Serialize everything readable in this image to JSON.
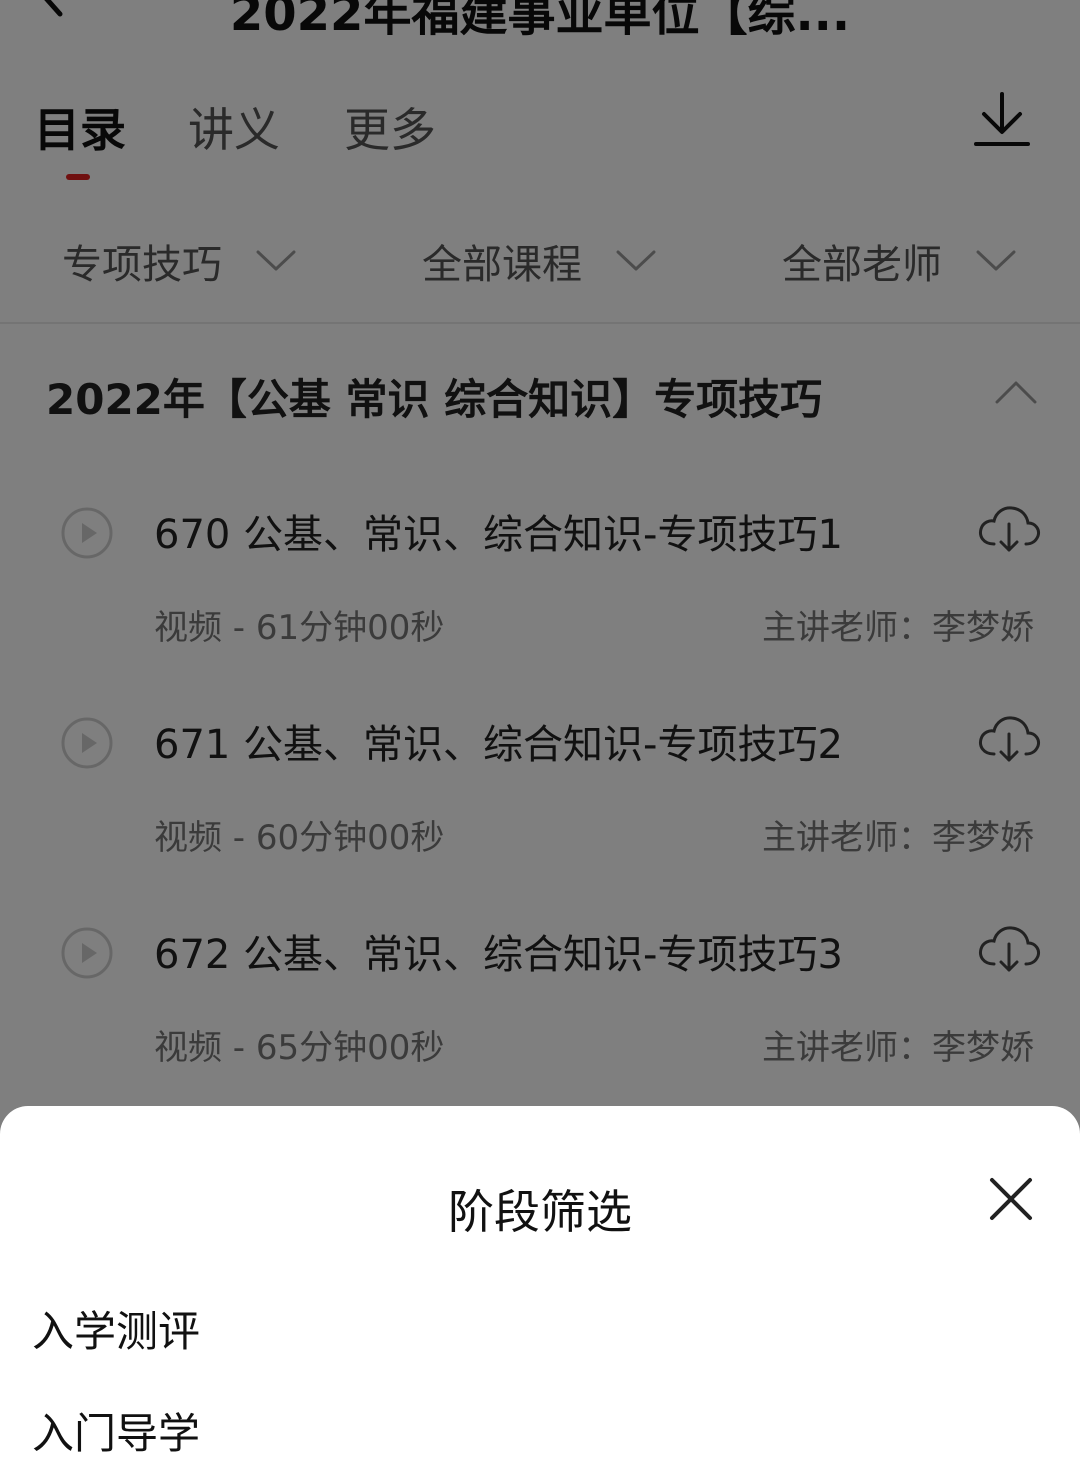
{
  "header": {
    "title": "2022年福建事业单位【综..."
  },
  "tabs": [
    {
      "label": "目录"
    },
    {
      "label": "讲义"
    },
    {
      "label": "更多"
    }
  ],
  "filters": [
    {
      "label": "专项技巧"
    },
    {
      "label": "全部课程"
    },
    {
      "label": "全部老师"
    }
  ],
  "section": {
    "title": "2022年【公基 常识 综合知识】专项技巧"
  },
  "lessons": [
    {
      "title": "670 公基、常识、综合知识-专项技巧1",
      "meta": "视频 - 61分钟00秒",
      "teacher": "主讲老师：李梦娇"
    },
    {
      "title": "671 公基、常识、综合知识-专项技巧2",
      "meta": "视频 - 60分钟00秒",
      "teacher": "主讲老师：李梦娇"
    },
    {
      "title": "672 公基、常识、综合知识-专项技巧3",
      "meta": "视频 - 65分钟00秒",
      "teacher": "主讲老师：李梦娇"
    }
  ],
  "sheet": {
    "title": "阶段筛选",
    "options": [
      {
        "label": "入学测评"
      },
      {
        "label": "入门导学"
      }
    ]
  },
  "icons": {
    "back": "back-arrow-icon",
    "download_all": "download-icon",
    "filter_chevron": "chevron-down-icon",
    "collapse": "chevron-up-icon",
    "play": "play-circle-icon",
    "lesson_download": "cloud-download-icon",
    "close": "close-icon"
  },
  "colors": {
    "accent": "#e02020",
    "overlay": "#000000"
  }
}
